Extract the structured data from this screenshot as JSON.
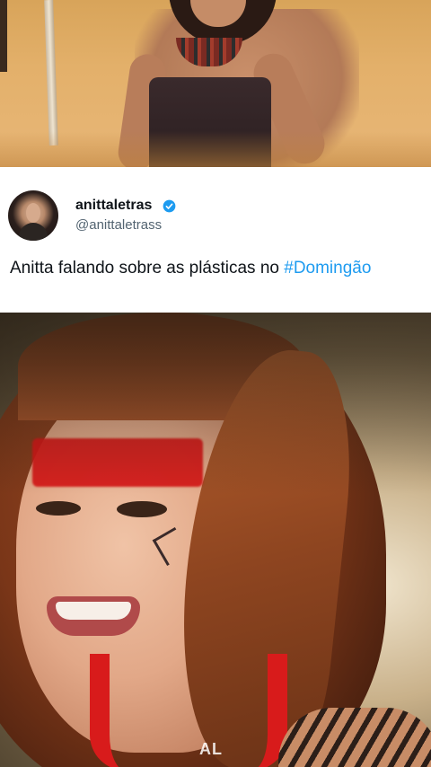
{
  "tweet": {
    "display_name": "anittaletras",
    "handle": "@anittaletrass",
    "verified_icon": "verified-badge-icon",
    "text": "Anitta falando sobre as plásticas no ",
    "hashtag": "#Domingão"
  },
  "bottom_media": {
    "watermark": "AL"
  },
  "colors": {
    "verified_blue": "#1d9bf0",
    "hashtag_blue": "#1d9bf0",
    "text_primary": "#0f1419",
    "text_secondary": "#536471"
  }
}
